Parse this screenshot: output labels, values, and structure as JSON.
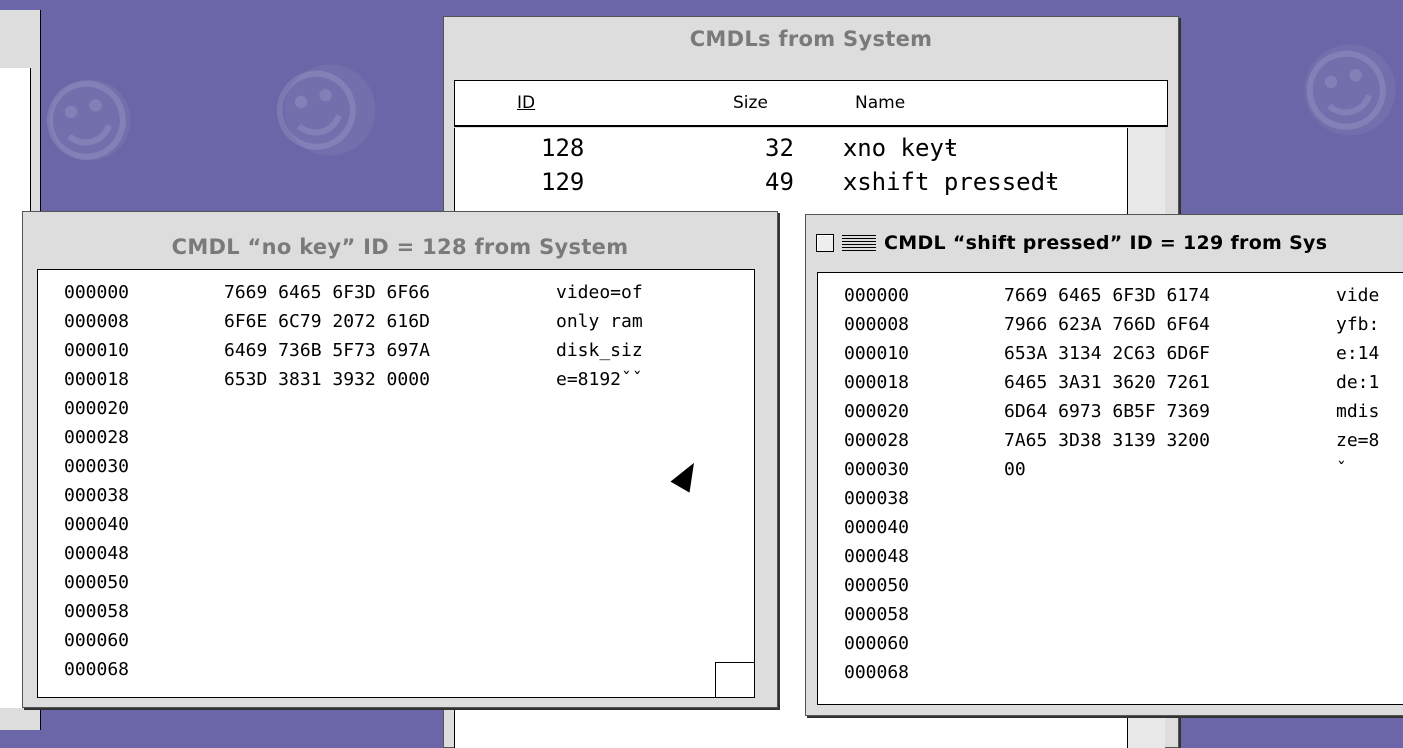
{
  "desktop": {
    "background": "#6a66a8"
  },
  "list_window": {
    "title": "CMDLs from System",
    "columns": {
      "id": "ID",
      "size": "Size",
      "name": "Name"
    },
    "rows": [
      {
        "id": "128",
        "size": "32",
        "name": "ⅹno keyŧ"
      },
      {
        "id": "129",
        "size": "49",
        "name": "ⅹshift pressedŧ"
      }
    ]
  },
  "hex_window_1": {
    "title": "CMDL “no key” ID = 128 from System",
    "lines": [
      {
        "offset": "000000",
        "hex": "7669 6465 6F3D 6F66",
        "ascii": "video=of"
      },
      {
        "offset": "000008",
        "hex": "6F6E 6C79 2072 616D",
        "ascii": "only ram"
      },
      {
        "offset": "000010",
        "hex": "6469 736B 5F73 697A",
        "ascii": "disk_siz"
      },
      {
        "offset": "000018",
        "hex": "653D 3831 3932 0000",
        "ascii": "e=8192ˇˇ"
      },
      {
        "offset": "000020",
        "hex": "",
        "ascii": ""
      },
      {
        "offset": "000028",
        "hex": "",
        "ascii": ""
      },
      {
        "offset": "000030",
        "hex": "",
        "ascii": ""
      },
      {
        "offset": "000038",
        "hex": "",
        "ascii": ""
      },
      {
        "offset": "000040",
        "hex": "",
        "ascii": ""
      },
      {
        "offset": "000048",
        "hex": "",
        "ascii": ""
      },
      {
        "offset": "000050",
        "hex": "",
        "ascii": ""
      },
      {
        "offset": "000058",
        "hex": "",
        "ascii": ""
      },
      {
        "offset": "000060",
        "hex": "",
        "ascii": ""
      },
      {
        "offset": "000068",
        "hex": "",
        "ascii": ""
      }
    ]
  },
  "hex_window_2": {
    "title": "CMDL “shift pressed” ID = 129 from Sys",
    "lines": [
      {
        "offset": "000000",
        "hex": "7669 6465 6F3D 6174",
        "ascii": "vide"
      },
      {
        "offset": "000008",
        "hex": "7966 623A 766D 6F64",
        "ascii": "yfb:"
      },
      {
        "offset": "000010",
        "hex": "653A 3134 2C63 6D6F",
        "ascii": "e:14"
      },
      {
        "offset": "000018",
        "hex": "6465 3A31 3620 7261",
        "ascii": "de:1"
      },
      {
        "offset": "000020",
        "hex": "6D64 6973 6B5F 7369",
        "ascii": "mdis"
      },
      {
        "offset": "000028",
        "hex": "7A65 3D38 3139 3200",
        "ascii": "ze=8"
      },
      {
        "offset": "000030",
        "hex": "00",
        "ascii": "ˇ"
      },
      {
        "offset": "000038",
        "hex": "",
        "ascii": ""
      },
      {
        "offset": "000040",
        "hex": "",
        "ascii": ""
      },
      {
        "offset": "000048",
        "hex": "",
        "ascii": ""
      },
      {
        "offset": "000050",
        "hex": "",
        "ascii": ""
      },
      {
        "offset": "000058",
        "hex": "",
        "ascii": ""
      },
      {
        "offset": "000060",
        "hex": "",
        "ascii": ""
      },
      {
        "offset": "000068",
        "hex": "",
        "ascii": ""
      }
    ]
  }
}
